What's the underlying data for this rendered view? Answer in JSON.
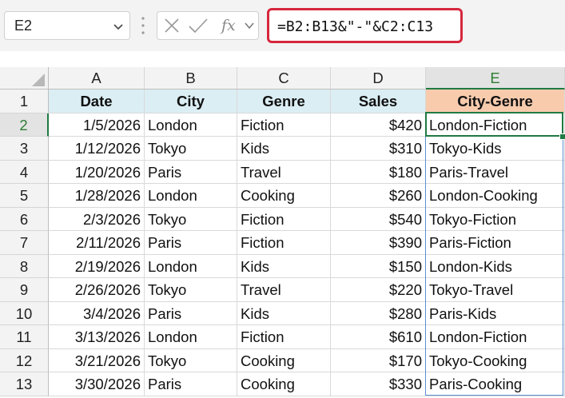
{
  "formula_bar": {
    "name_box": "E2",
    "fx_label": "fx",
    "formula": "=B2:B13&\"-\"&C2:C13"
  },
  "columns": [
    "A",
    "B",
    "C",
    "D",
    "E"
  ],
  "row_numbers": [
    "1",
    "2",
    "3",
    "4",
    "5",
    "6",
    "7",
    "8",
    "9",
    "10",
    "11",
    "12",
    "13"
  ],
  "headers": {
    "date": "Date",
    "city": "City",
    "genre": "Genre",
    "sales": "Sales",
    "city_genre": "City-Genre"
  },
  "rows": [
    {
      "date": "1/5/2026",
      "city": "London",
      "genre": "Fiction",
      "sales": "$420",
      "city_genre": "London-Fiction"
    },
    {
      "date": "1/12/2026",
      "city": "Tokyo",
      "genre": "Kids",
      "sales": "$310",
      "city_genre": "Tokyo-Kids"
    },
    {
      "date": "1/20/2026",
      "city": "Paris",
      "genre": "Travel",
      "sales": "$180",
      "city_genre": "Paris-Travel"
    },
    {
      "date": "1/28/2026",
      "city": "London",
      "genre": "Cooking",
      "sales": "$260",
      "city_genre": "London-Cooking"
    },
    {
      "date": "2/3/2026",
      "city": "Tokyo",
      "genre": "Fiction",
      "sales": "$540",
      "city_genre": "Tokyo-Fiction"
    },
    {
      "date": "2/11/2026",
      "city": "Paris",
      "genre": "Fiction",
      "sales": "$390",
      "city_genre": "Paris-Fiction"
    },
    {
      "date": "2/19/2026",
      "city": "London",
      "genre": "Kids",
      "sales": "$150",
      "city_genre": "London-Kids"
    },
    {
      "date": "2/26/2026",
      "city": "Tokyo",
      "genre": "Travel",
      "sales": "$220",
      "city_genre": "Tokyo-Travel"
    },
    {
      "date": "3/4/2026",
      "city": "Paris",
      "genre": "Kids",
      "sales": "$280",
      "city_genre": "Paris-Kids"
    },
    {
      "date": "3/13/2026",
      "city": "London",
      "genre": "Fiction",
      "sales": "$610",
      "city_genre": "London-Fiction"
    },
    {
      "date": "3/21/2026",
      "city": "Tokyo",
      "genre": "Cooking",
      "sales": "$170",
      "city_genre": "Tokyo-Cooking"
    },
    {
      "date": "3/30/2026",
      "city": "Paris",
      "genre": "Cooking",
      "sales": "$330",
      "city_genre": "Paris-Cooking"
    }
  ],
  "colors": {
    "header_fill": "#dbeef4",
    "result_header_fill": "#f8cbad",
    "formula_highlight": "#d6273d",
    "selection": "#1f7a43"
  },
  "icons": {
    "name_box_dropdown": "chevron-down-icon",
    "cancel": "close-icon",
    "enter": "check-icon",
    "function": "fx-icon",
    "formula_dropdown": "chevron-down-icon"
  }
}
